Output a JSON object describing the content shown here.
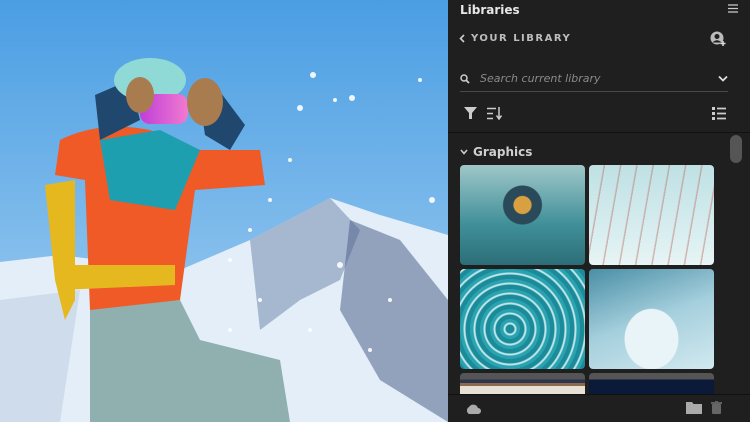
{
  "panel": {
    "title": "Libraries",
    "back_label": "YOUR LIBRARY",
    "search_placeholder": "Search current library",
    "section_label": "Graphics"
  },
  "colors": {
    "panel_bg": "#1f1f1f",
    "text": "#d6d6d6"
  }
}
